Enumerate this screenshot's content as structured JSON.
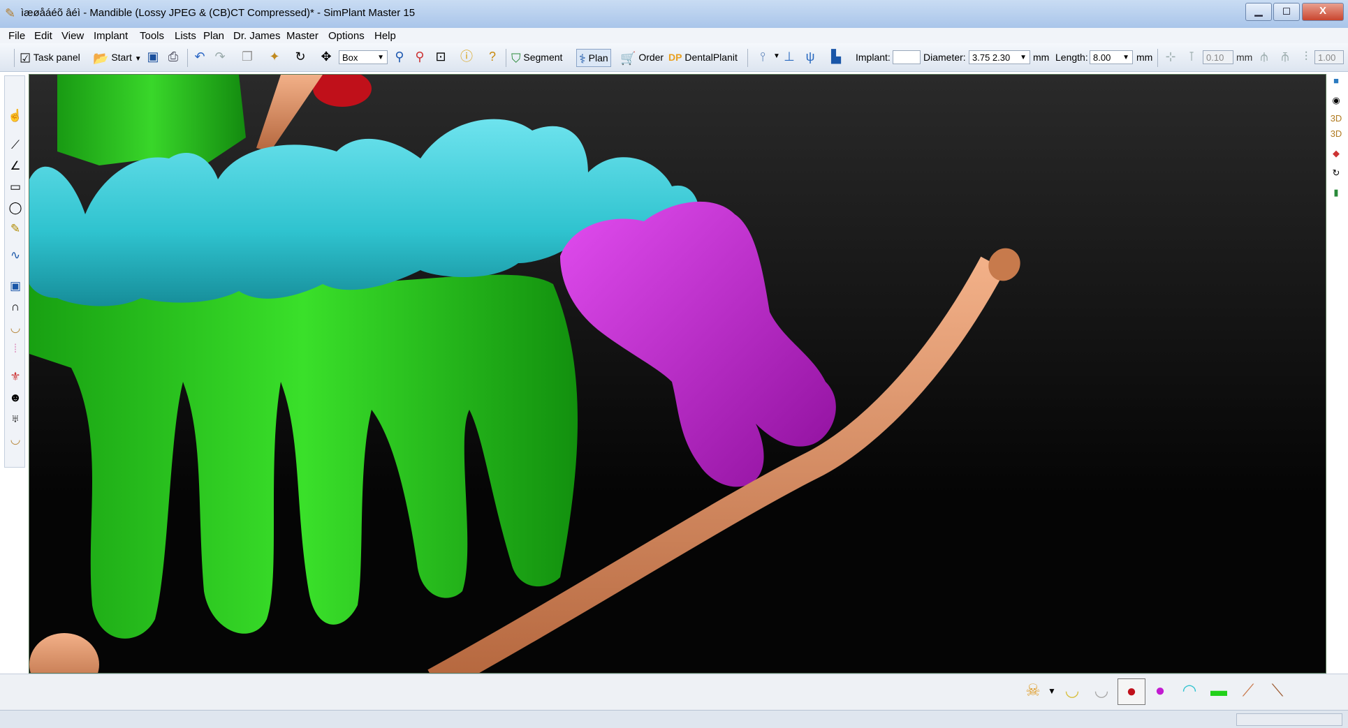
{
  "window": {
    "title": "ìæøåáéõ âéì - Mandible (Lossy JPEG & (CB)CT Compressed)* - SimPlant Master 15",
    "controls": {
      "minimize": "▁",
      "maximize": "◻",
      "close": "X"
    }
  },
  "menu": [
    "File",
    "Edit",
    "View",
    "Implant",
    "Tools",
    "Lists",
    "Plan",
    "Dr. James",
    "Master",
    "Options",
    "Help"
  ],
  "toolbar": {
    "task_panel": "Task panel",
    "start": "Start",
    "selection_mode": "Box",
    "segment": "Segment",
    "plan": "Plan",
    "order": "Order",
    "dentalplanit_logo": "DP",
    "dentalplanit": "DentalPlanit",
    "implant_label": "Implant:",
    "implant_value": "",
    "diameter_label": "Diameter:",
    "diameter_value": "3.75  2.30",
    "diameter_unit": "mm",
    "length_label": "Length:",
    "length_value": "8.00",
    "length_unit": "mm",
    "offset_value": "0.10",
    "offset_unit": "mm",
    "scale_value": "1.00"
  },
  "colors": {
    "crowns": "#2fc3cf",
    "roots": "#22d11a",
    "third_molar": "#c21bd1",
    "nerve_canal": "#d98a5a",
    "red_object": "#c0101a",
    "viewport_bg": "#0b0b0b"
  },
  "object_tray": [
    "skull-icon",
    "mandible-yellow-icon",
    "mandible-gray-icon",
    "red-object-icon",
    "magenta-tooth-icon",
    "cyan-arch-icon",
    "green-teeth-icon",
    "nerve-orange-icon",
    "nerve-brown-icon"
  ]
}
